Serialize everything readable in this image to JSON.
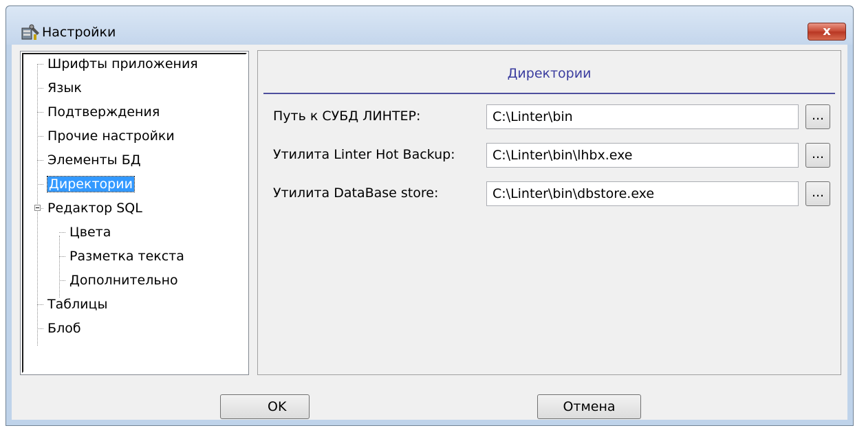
{
  "window": {
    "title": "Настройки",
    "close_label": "x"
  },
  "tree": {
    "items": [
      {
        "label": "Шрифты приложения"
      },
      {
        "label": "Язык"
      },
      {
        "label": "Подтверждения"
      },
      {
        "label": "Прочие настройки"
      },
      {
        "label": "Элементы БД"
      },
      {
        "label": "Директории",
        "selected": true
      },
      {
        "label": "Редактор SQL",
        "expanded": true,
        "children": [
          {
            "label": "Цвета"
          },
          {
            "label": "Разметка текста"
          },
          {
            "label": "Дополнительно"
          }
        ]
      },
      {
        "label": "Таблицы"
      },
      {
        "label": "Блоб"
      }
    ]
  },
  "panel": {
    "title": "Директории",
    "fields": [
      {
        "label": "Путь к СУБД ЛИНТЕР:",
        "value": "C:\\Linter\\bin",
        "button": "..."
      },
      {
        "label": "Утилита Linter Hot Backup:",
        "value": "C:\\Linter\\bin\\lhbx.exe",
        "button": "..."
      },
      {
        "label": "Утилита DataBase store:",
        "value": "C:\\Linter\\bin\\dbstore.exe",
        "button": "..."
      }
    ]
  },
  "buttons": {
    "ok": "OK",
    "cancel": "Отмена"
  },
  "colors": {
    "selection": "#3399ff",
    "section_title": "#3b3d9f",
    "close_button": "#c74a35"
  }
}
